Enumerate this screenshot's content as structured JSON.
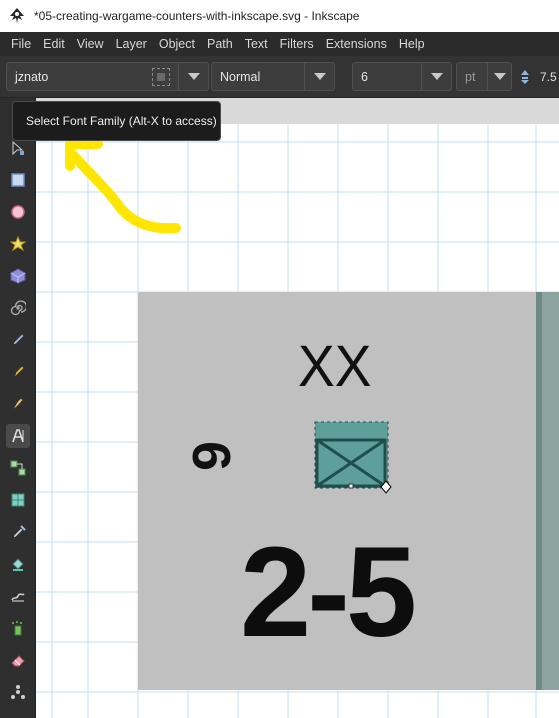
{
  "window": {
    "title": "*05-creating-wargame-counters-with-inkscape.svg - Inkscape"
  },
  "menu": {
    "items": [
      "File",
      "Edit",
      "View",
      "Layer",
      "Object",
      "Path",
      "Text",
      "Filters",
      "Extensions",
      "Help"
    ]
  },
  "toolbar": {
    "font_family": "jznato",
    "font_style": "Normal",
    "font_size": "6",
    "unit": "pt",
    "line_spacing": "7.5"
  },
  "tooltip": {
    "text": "Select Font Family (Alt-X to access)"
  },
  "tools": [
    "selector-icon",
    "node-icon",
    "rectangle-icon",
    "circle-icon",
    "star-icon",
    "box3d-icon",
    "spiral-icon",
    "pencil-icon",
    "pen-icon",
    "calligraphy-icon",
    "text-icon",
    "connector-icon",
    "mesh-icon",
    "dropper-icon",
    "paint-bucket-icon",
    "tweak-icon",
    "spray-icon",
    "eraser-icon",
    "measure-icon"
  ],
  "counter": {
    "unit_size": "XX",
    "side_value": "6",
    "strength": "2-5"
  },
  "colors": {
    "annotation_arrow": "#ffe600",
    "counter_background": "#c0c0c0",
    "unit_symbol_fill": "#5f9f9b",
    "grid_line": "#c7dff2"
  }
}
